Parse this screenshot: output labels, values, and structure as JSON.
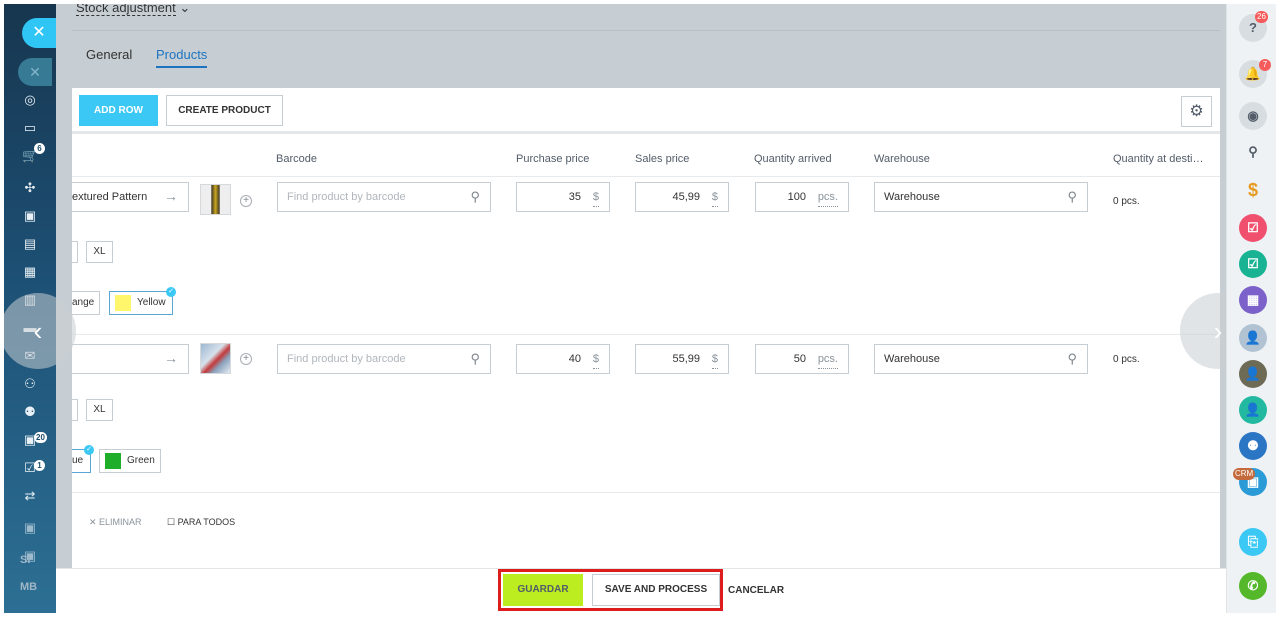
{
  "header": {
    "slider_title": "Stock adjustment",
    "tabs": [
      "General",
      "Products"
    ]
  },
  "toolbar": {
    "add_row": "ADD ROW",
    "create_product": "CREATE PRODUCT"
  },
  "columns": [
    "Barcode",
    "Purchase price",
    "Sales price",
    "Quantity arrived",
    "Warehouse",
    "Quantity at desti…"
  ],
  "rows": [
    {
      "name": "extured Pattern",
      "barcode_placeholder": "Find product by barcode",
      "purchase_price": "35",
      "sales_price": "45,99",
      "currency": "$",
      "quantity": "100",
      "unit": "pcs.",
      "warehouse": "Warehouse",
      "qty_at_dest": "0 pcs.",
      "size": "XL",
      "colors": [
        "ange",
        "Yellow"
      ],
      "color_swatch": "#fff66b"
    },
    {
      "name": "",
      "barcode_placeholder": "Find product by barcode",
      "purchase_price": "40",
      "sales_price": "55,99",
      "currency": "$",
      "quantity": "50",
      "unit": "pcs.",
      "warehouse": "Warehouse",
      "qty_at_dest": "0 pcs.",
      "size": "XL",
      "colors": [
        "ue",
        "Green"
      ],
      "color_swatch": "#1fae2a"
    }
  ],
  "actions": {
    "delete": "ELIMINAR",
    "for_all": "PARA TODOS"
  },
  "bottom": {
    "save": "GUARDAR",
    "save_process": "SAVE AND PROCESS",
    "cancel": "CANCELAR"
  },
  "left_nav": {
    "badges": [
      "6",
      "20",
      "1"
    ],
    "texts": [
      "SI",
      "MB"
    ]
  },
  "right_bar": {
    "badges": [
      "26",
      "7"
    ],
    "crm_label": "CRM"
  }
}
